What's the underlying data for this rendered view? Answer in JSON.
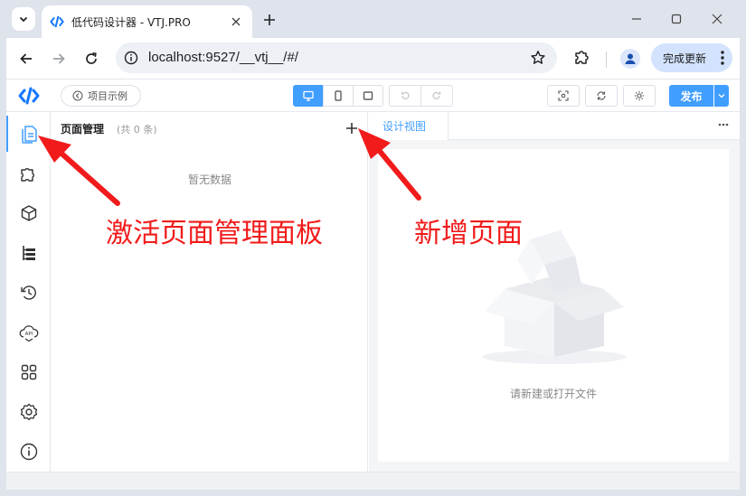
{
  "browser": {
    "tab_title": "低代码设计器 - VTJ.PRO",
    "url": "localhost:9527/__vtj__/#/",
    "update_label": "完成更新"
  },
  "appbar": {
    "demo_label": "项目示例",
    "publish_label": "发布"
  },
  "sidebar": {
    "items": [
      {
        "icon": "pages-icon",
        "active": true
      },
      {
        "icon": "puzzle-icon"
      },
      {
        "icon": "cube-icon"
      },
      {
        "icon": "tree-icon"
      },
      {
        "icon": "history-icon"
      },
      {
        "icon": "api-cloud-icon"
      },
      {
        "icon": "apps-icon"
      },
      {
        "icon": "gear-icon"
      },
      {
        "icon": "info-icon"
      }
    ]
  },
  "panel": {
    "title": "页面管理",
    "count": "(共 0 条)",
    "empty_text": "暂无数据"
  },
  "workspace": {
    "tab_label": "设计视图",
    "empty_text": "请新建或打开文件"
  },
  "annotations": {
    "activate_panel": "激活页面管理面板",
    "add_page": "新增页面",
    "color": "#f11b1b"
  },
  "colors": {
    "accent": "#409eff",
    "chrome": "#dfe3eb"
  }
}
